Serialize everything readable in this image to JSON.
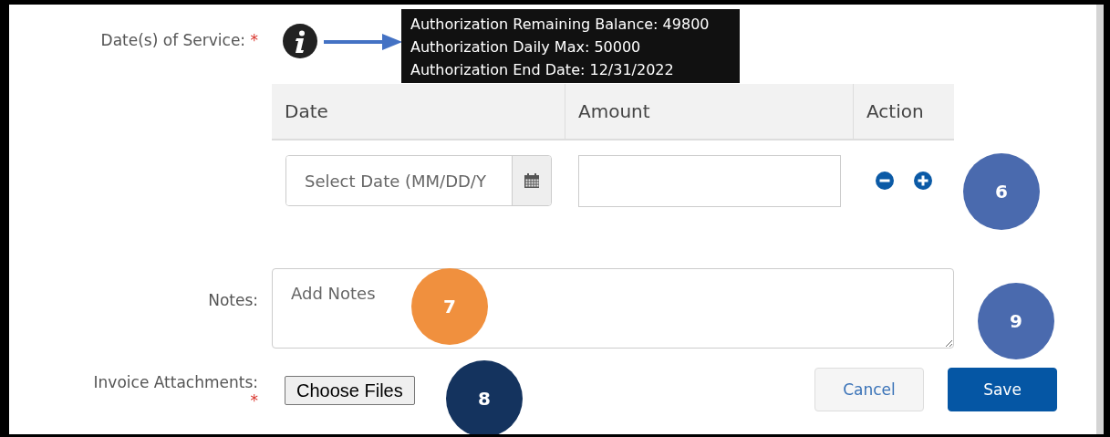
{
  "dates_of_service": {
    "label": "Date(s) of Service:",
    "required_mark": "*"
  },
  "tooltip": {
    "lines": [
      "Authorization Remaining Balance: 49800",
      "Authorization Daily Max: 50000",
      "Authorization End Date: 12/31/2022"
    ]
  },
  "table": {
    "columns": [
      "Date",
      "Amount",
      "Action"
    ],
    "rows": [
      {
        "date": {
          "placeholder": "Select Date (MM/DD/Y"
        }
      }
    ]
  },
  "notes": {
    "label": "Notes:",
    "placeholder": "Add Notes"
  },
  "invoice_attachments": {
    "label": "Invoice Attachments:",
    "required_mark": "*",
    "button": "Choose Files"
  },
  "buttons": [
    {
      "label": "Cancel",
      "kind": "secondary"
    },
    {
      "label": "Save",
      "kind": "primary"
    }
  ],
  "callouts": [
    {
      "number": "6",
      "color": "#4a6aae"
    },
    {
      "number": "7",
      "color": "#f0903e"
    },
    {
      "number": "8",
      "color": "#14335e"
    },
    {
      "number": "9",
      "color": "#4a6aae"
    }
  ]
}
